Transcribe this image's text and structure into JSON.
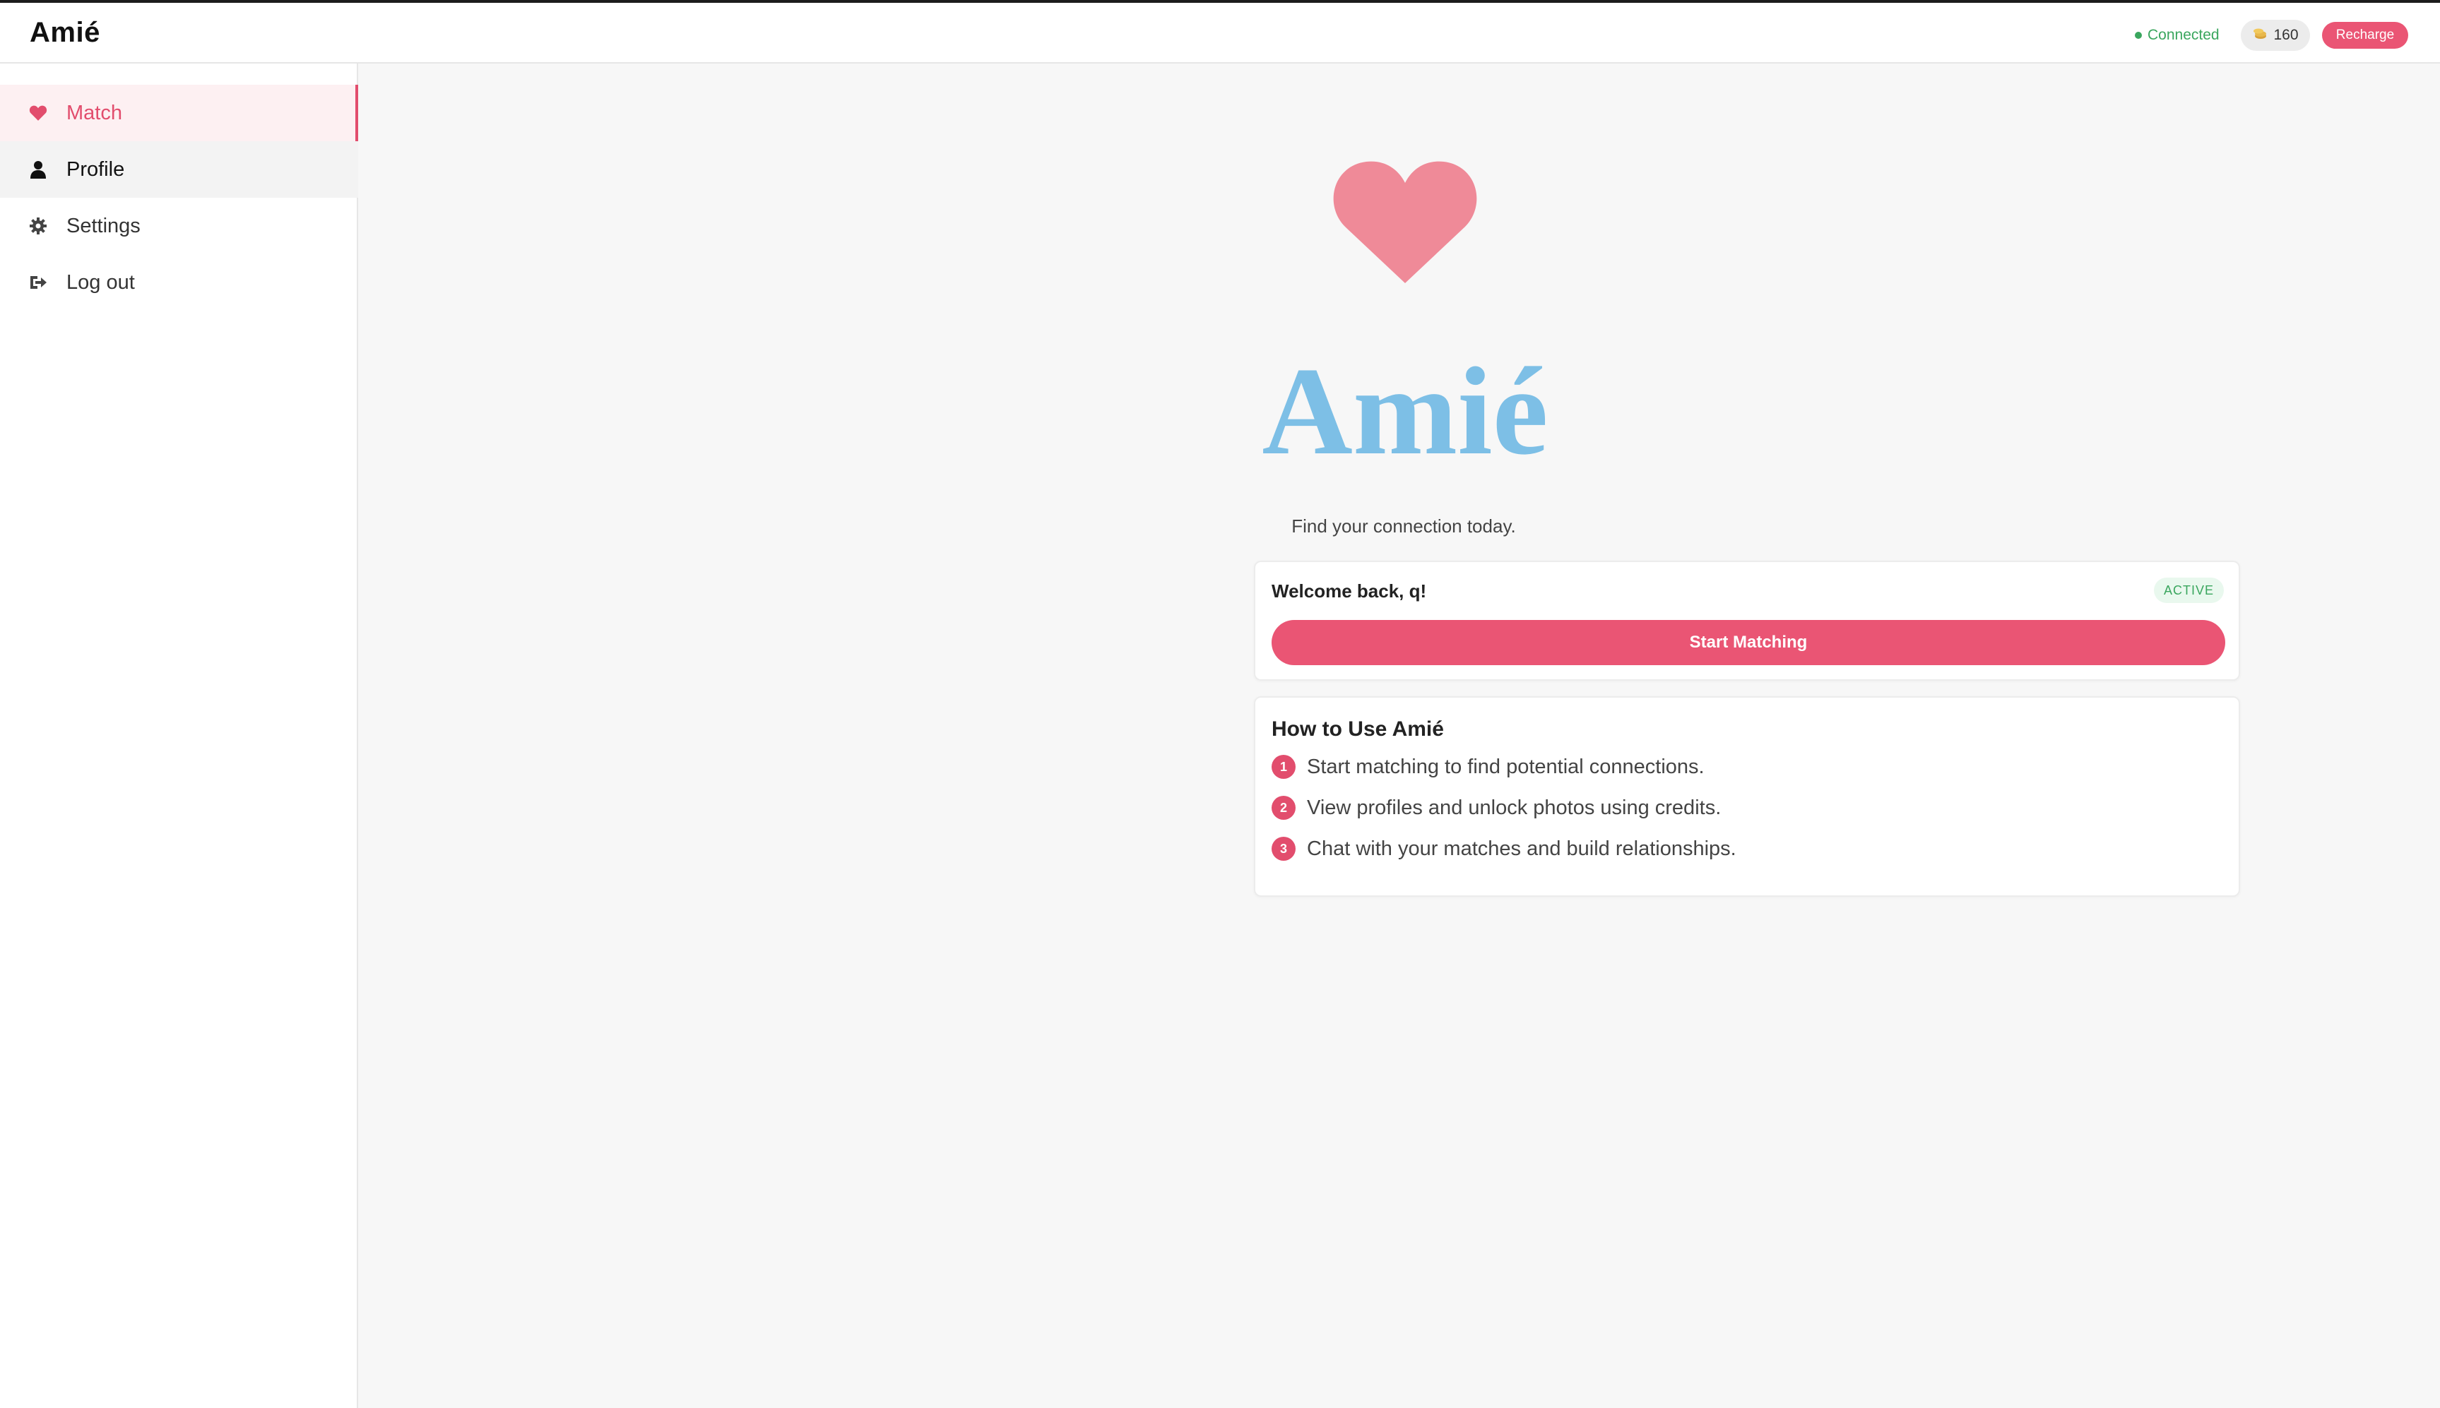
{
  "header": {
    "app_title": "Amié",
    "status": "Connected",
    "credits": "160",
    "recharge_label": "Recharge"
  },
  "sidebar": {
    "items": [
      {
        "label": "Match",
        "icon": "heart-icon",
        "state": "active"
      },
      {
        "label": "Profile",
        "icon": "user-icon",
        "state": "hover"
      },
      {
        "label": "Settings",
        "icon": "gear-icon",
        "state": "normal"
      },
      {
        "label": "Log out",
        "icon": "logout-icon",
        "state": "normal"
      }
    ]
  },
  "main": {
    "logo_text": "Amié",
    "tagline": "Find your connection today.",
    "welcome_card": {
      "greeting": "Welcome back, q!",
      "badge": "ACTIVE",
      "button_label": "Start Matching"
    },
    "howto": {
      "title": "How to Use Amié",
      "steps": [
        {
          "num": "1",
          "text": "Start matching to find potential connections."
        },
        {
          "num": "2",
          "text": "View profiles and unlock photos using credits."
        },
        {
          "num": "3",
          "text": "Chat with your matches and build relationships."
        }
      ]
    }
  },
  "colors": {
    "accent": "#ea5574",
    "heart_logo": "#ef8a98",
    "logo_text": "#7dbfe6",
    "status_green": "#3aa65e"
  }
}
